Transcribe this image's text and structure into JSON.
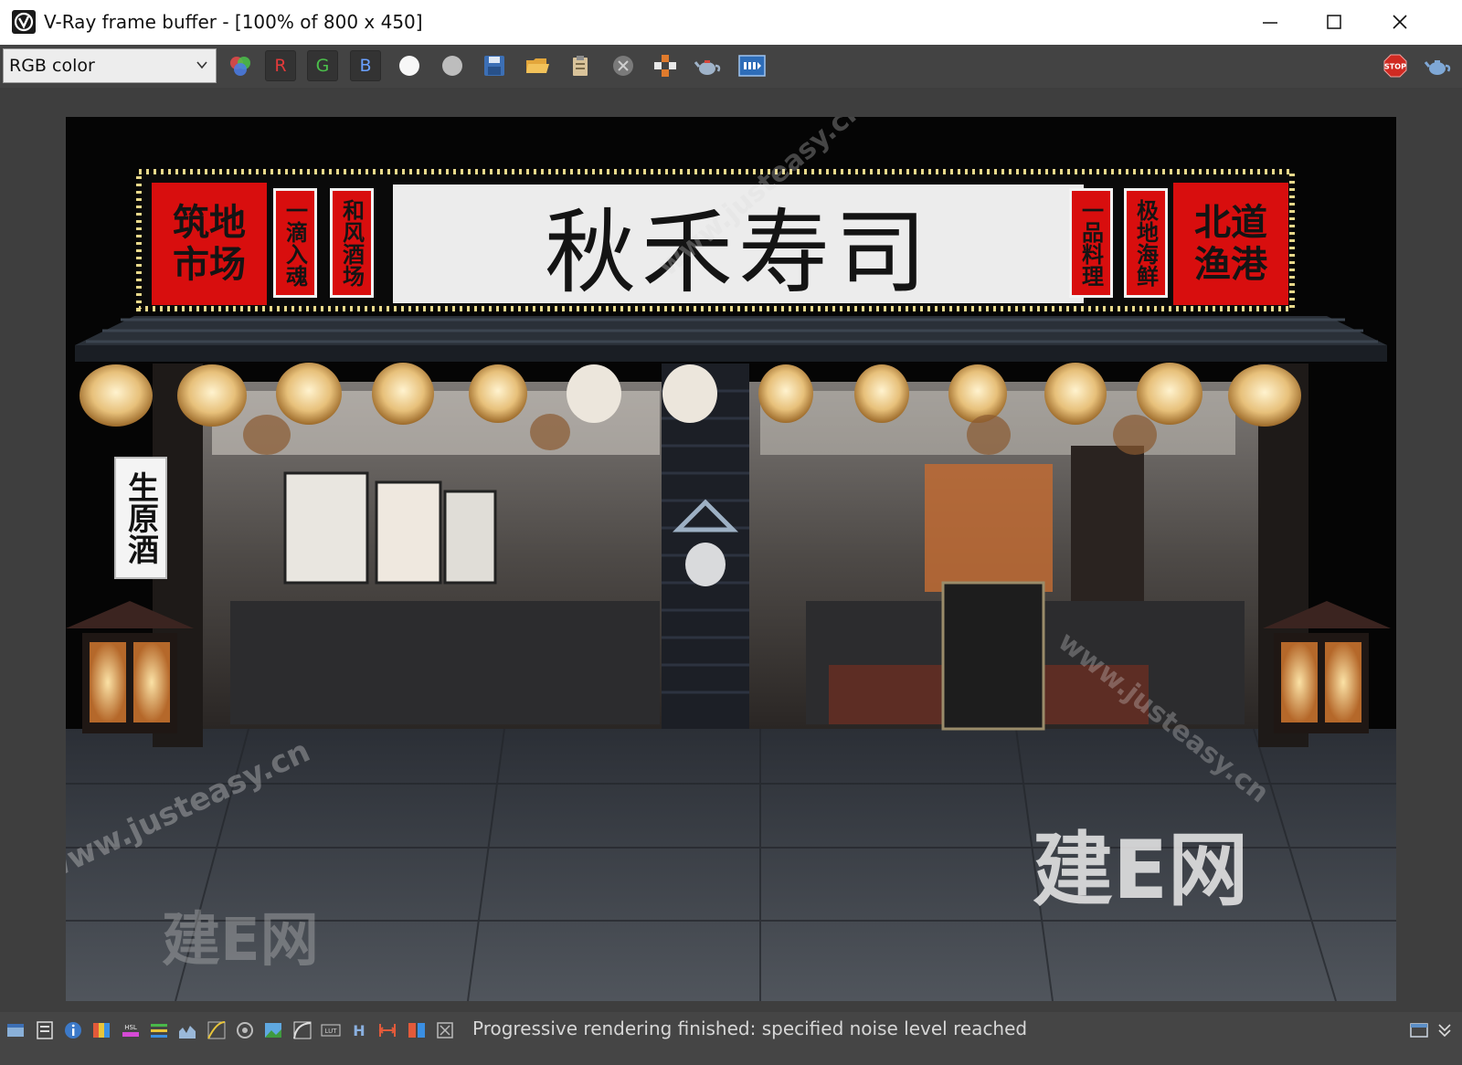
{
  "window": {
    "title": "V-Ray frame buffer - [100% of 800 x 450]",
    "app_icon": "vray-logo-icon",
    "controls": [
      "minimize-icon",
      "maximize-icon",
      "close-icon"
    ]
  },
  "toolbar": {
    "channel_select": {
      "value": "RGB color"
    },
    "channel_buttons": {
      "r": "R",
      "g": "G",
      "b": "B"
    },
    "icons": [
      "color-channels-icon",
      "white-point-icon",
      "gray-point-icon",
      "save-image-icon",
      "open-folder-icon",
      "clipboard-icon",
      "clear-image-icon",
      "region-render-icon",
      "teapot-render-icon",
      "lens-effects-icon",
      "stop-render-icon",
      "teapot-icon"
    ],
    "stop_label": "STOP"
  },
  "render": {
    "main_sign": "秋禾寿司",
    "left_red_sign": [
      "筑地",
      "市场"
    ],
    "left_vertical_1": "一滴入魂",
    "left_vertical_2": "和风酒场",
    "right_vertical_1": "一品料理",
    "right_vertical_2": "极地海鲜",
    "right_red_sign": [
      "北道",
      "渔港"
    ],
    "side_sign": "生原酒",
    "watermarks": {
      "brand": "建E网",
      "url": "www.justeasy.cn"
    }
  },
  "statusbar": {
    "icons": [
      "history-icon",
      "stats-icon",
      "info-icon",
      "color-corrections-icon",
      "hsl-icon",
      "levels-icon",
      "histogram-icon",
      "curves-icon",
      "lens-icon",
      "background-icon",
      "curve-icon",
      "lut-icon",
      "hdr-icon",
      "exposure-icon",
      "compare-icon",
      "pixel-info-icon"
    ],
    "hsl_label": "HSL",
    "lut_label": "LUT",
    "h_label": "H",
    "message": "Progressive rendering finished: specified noise level reached",
    "right_icons": [
      "panel-toggle-icon",
      "chevron-down-icon"
    ]
  }
}
